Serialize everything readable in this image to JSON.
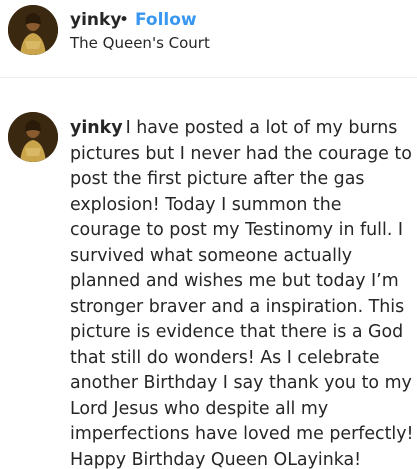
{
  "header": {
    "username": "yinky",
    "separator": "•",
    "follow_label": "Follow",
    "location": "The Queen's Court",
    "avatar_icon": "profile-avatar"
  },
  "caption": {
    "username": "yinky",
    "text": "I have posted a lot of my burns pictures but I never had the courage to post the first picture after the gas explosion! Today I summon the courage to post my Testinomy in full. I survived what someone actually planned and wishes me but today I’m stronger braver and a inspiration. This picture is evidence that there is a God that still do wonders! As I celebrate another Birthday I say thank you to my Lord Jesus who despite all my imperfections have loved me perfectly! Happy Birthday Queen OLayinka!",
    "avatar_icon": "profile-avatar"
  },
  "colors": {
    "follow": "#3897f0",
    "text": "#262626",
    "divider": "#efefef"
  }
}
